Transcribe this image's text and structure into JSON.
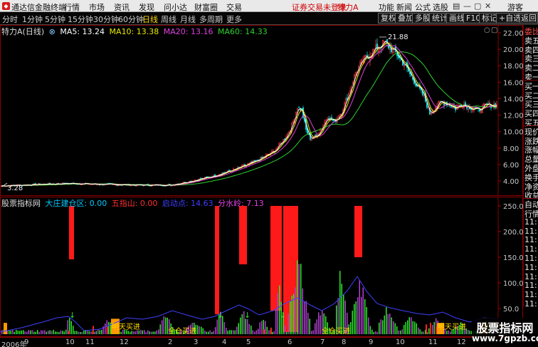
{
  "app": {
    "title": "通达信金融终端",
    "menu": [
      "行情",
      "市场",
      "资讯",
      "发现",
      "问小达",
      "财富圈",
      "交易"
    ],
    "login_status": "证券交易未登录",
    "stock_name": "特力A",
    "right_menu": [
      "功能",
      "新闻",
      "公式",
      "选股"
    ],
    "user": "游客"
  },
  "toolbar": {
    "tabs": [
      "分时",
      "1分钟",
      "5分钟",
      "15分钟",
      "30分钟",
      "60分钟",
      "日线",
      "周线",
      "月线",
      "多周期",
      "更多"
    ],
    "active_tab": "日线",
    "right_buttons": [
      "复权",
      "叠加",
      "多股",
      "统计",
      "画线",
      "F10",
      "标记",
      "+自选",
      "返回"
    ]
  },
  "main": {
    "header": {
      "title": "特力A(日线)",
      "ma5": "MA5: 13.24",
      "ma10": "MA10: 13.38",
      "ma20": "MA20: 13.16",
      "ma60": "MA60: 14.33"
    },
    "high_label": "21.88",
    "low_label": "3.28",
    "y_ticks": [
      "22.00",
      "20.00",
      "18.00",
      "16.00",
      "14.00",
      "12.00",
      "10.00",
      "8.00",
      "6.00",
      "4.00"
    ]
  },
  "indicator": {
    "header": {
      "name": "股票指标网",
      "item1": "大庄建仓区: 0.00",
      "item2": "五指山: 0.00",
      "item3": "启动点: 14.63",
      "item4": "分水岭: 7.13"
    },
    "y_ticks": [
      "250.0",
      "200.0",
      "150.0",
      "100.0",
      "50.0",
      "0.0"
    ],
    "annotations": [
      "明天买进",
      "全仓买进",
      "全仓买进",
      "明天买进",
      "明天买"
    ]
  },
  "xaxis": {
    "labels": [
      "2006年",
      "9",
      "10",
      "11",
      "12",
      "2",
      "3",
      "4",
      "5",
      "6",
      "7",
      "8",
      "9",
      "10",
      "11",
      "12"
    ]
  },
  "side_panel": {
    "items": [
      "委比",
      "卖五",
      "卖四",
      "卖三",
      "卖二",
      "卖一",
      "买一",
      "买二",
      "买三",
      "买四",
      "买五",
      "现价",
      "涨跌",
      "涨幅",
      "总量",
      "外盘",
      "换手",
      "净资",
      "收益",
      "自动",
      "行情",
      "11:",
      "11:",
      "11:",
      "11:",
      "11:",
      "11:",
      "11:",
      "11:",
      "11:",
      "11:"
    ]
  },
  "watermark": {
    "line1": "股票指标网",
    "line2": "www.7gpzb.com"
  },
  "colors": {
    "up": "#ff3c3c",
    "down": "#00d8d8",
    "ma5": "#ffffff",
    "ma10": "#e8e800",
    "ma20": "#e040e0",
    "ma60": "#30d030",
    "bar_red": "#ff1a1a",
    "vol_green": "#2ee82e",
    "vol_purple": "#b040d0",
    "band_blue": "#3f3fff",
    "orange": "#ff9900"
  }
}
